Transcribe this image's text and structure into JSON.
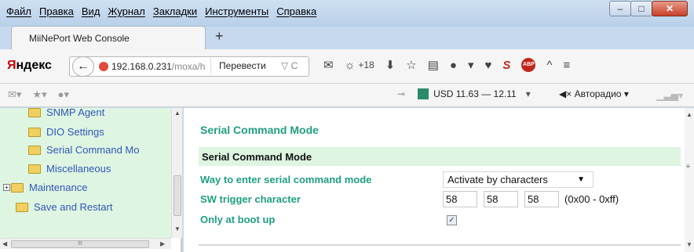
{
  "menu": [
    "Файл",
    "Правка",
    "Вид",
    "Журнал",
    "Закладки",
    "Инструменты",
    "Справка"
  ],
  "window_buttons": {
    "minimize": "–",
    "maximize": "□",
    "close": "✕"
  },
  "tab": {
    "title": "MiiNePort Web Console",
    "new_tab": "+"
  },
  "nav": {
    "brand_red": "Я",
    "brand_rest": "ндекс",
    "back": "←",
    "url_host": "192.168.0.231",
    "url_path": "/moxa/h",
    "translate": "Перевести",
    "url_icons": "▽ C",
    "weather": "+18"
  },
  "toolbar2": {
    "currency": "USD 11.63 — 12.11",
    "radio": "Авторадио"
  },
  "tree": {
    "items": [
      {
        "label": "SNMP Agent"
      },
      {
        "label": "DIO Settings"
      },
      {
        "label": "Serial Command Mo"
      },
      {
        "label": "Miscellaneous"
      },
      {
        "label": "Maintenance"
      },
      {
        "label": "Save and Restart"
      }
    ],
    "scroll_h_label": "III"
  },
  "main": {
    "heading": "Serial Command Mode",
    "section_title": "Serial Command Mode",
    "labels": {
      "way": "Way to enter serial command mode",
      "trigger": "SW trigger character",
      "boot": "Only at boot up"
    },
    "way_value": "Activate by characters",
    "trigger_values": [
      "58",
      "58",
      "58"
    ],
    "trigger_range": "(0x00 - 0xff)",
    "boot_checked": "✓"
  },
  "colors": {
    "accent": "#1f9f82",
    "tree_bg": "#ddf5e1",
    "link": "#3355bb"
  }
}
